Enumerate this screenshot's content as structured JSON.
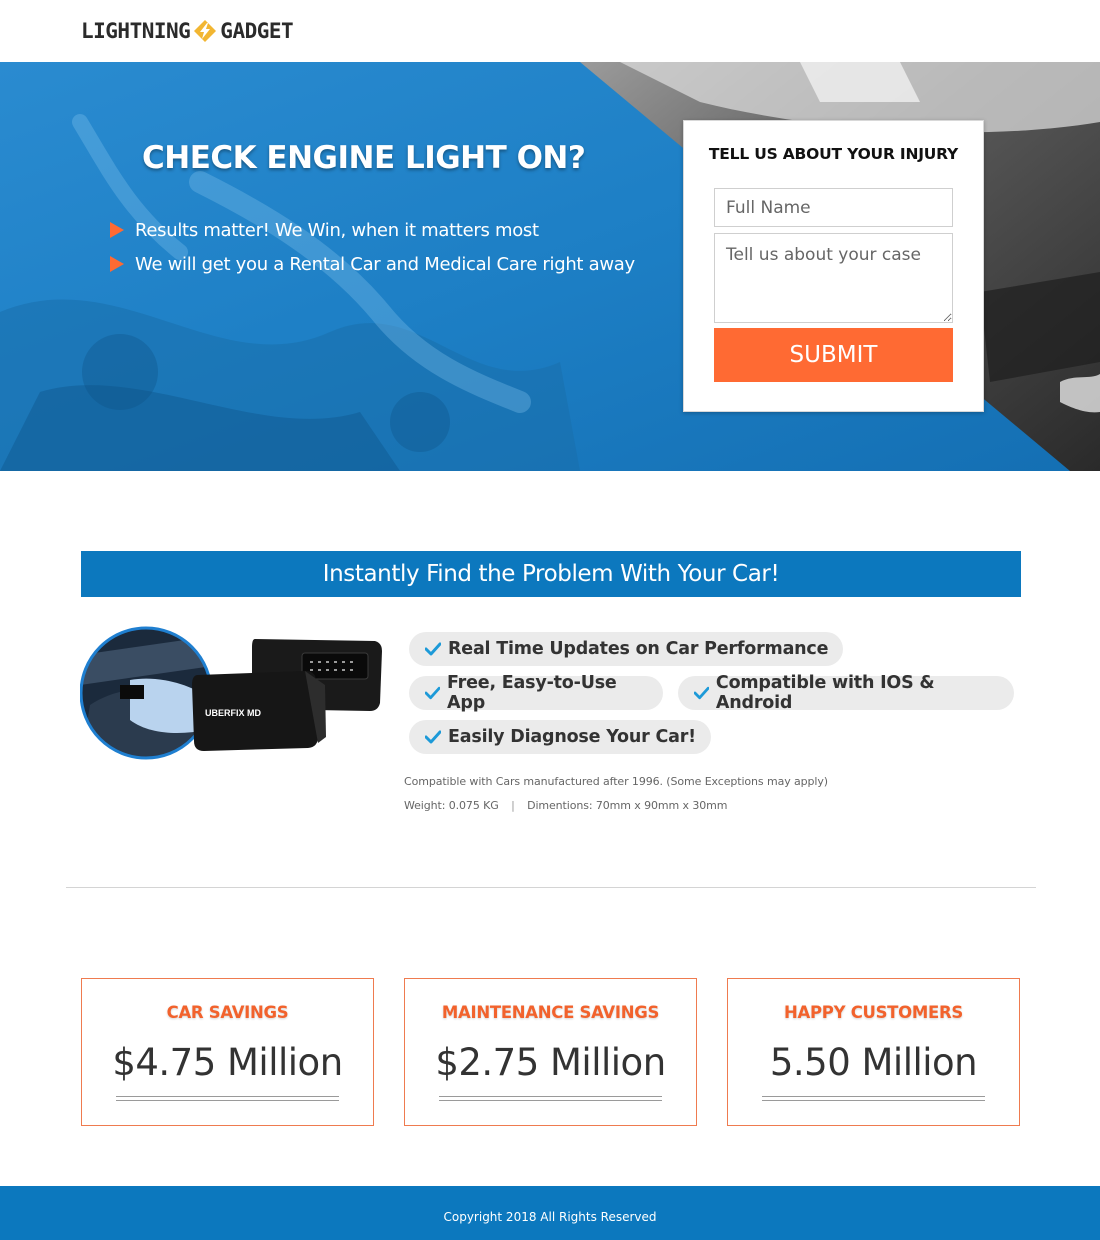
{
  "header": {
    "logo_left": "LIGHTNING",
    "logo_right": "GADGET"
  },
  "hero": {
    "title": "CHECK ENGINE LIGHT ON?",
    "bullets": [
      "Results matter! We Win, when it matters most",
      "We will get you a Rental Car and Medical Care right away"
    ]
  },
  "form": {
    "title": "TELL US ABOUT YOUR INJURY",
    "name_placeholder": "Full Name",
    "case_placeholder": "Tell us about your case",
    "submit_label": "SUBMIT"
  },
  "features": {
    "banner": "Instantly Find the Problem With Your Car!",
    "product_brand": "UBERFIX MD",
    "chips": [
      "Real Time Updates on Car Performance",
      "Free, Easy-to-Use App",
      "Compatible with IOS & Android",
      "Easily Diagnose Your Car!"
    ],
    "compat_note": "Compatible with Cars manufactured after 1996. (Some Exceptions may apply)",
    "weight": "Weight: 0.075 KG",
    "separator": "|",
    "dimensions": "Dimentions: 70mm x 90mm x 30mm"
  },
  "stats": [
    {
      "label": "CAR SAVINGS",
      "value": "$4.75 Million"
    },
    {
      "label": "MAINTENANCE SAVINGS",
      "value": "$2.75 Million"
    },
    {
      "label": "HAPPY CUSTOMERS",
      "value": "5.50 Million"
    }
  ],
  "footer": {
    "copyright": "Copyright 2018 All Rights Reserved"
  },
  "colors": {
    "brand_blue": "#0c78be",
    "accent_orange": "#ff6a33",
    "logo_gold": "#f2b632"
  }
}
